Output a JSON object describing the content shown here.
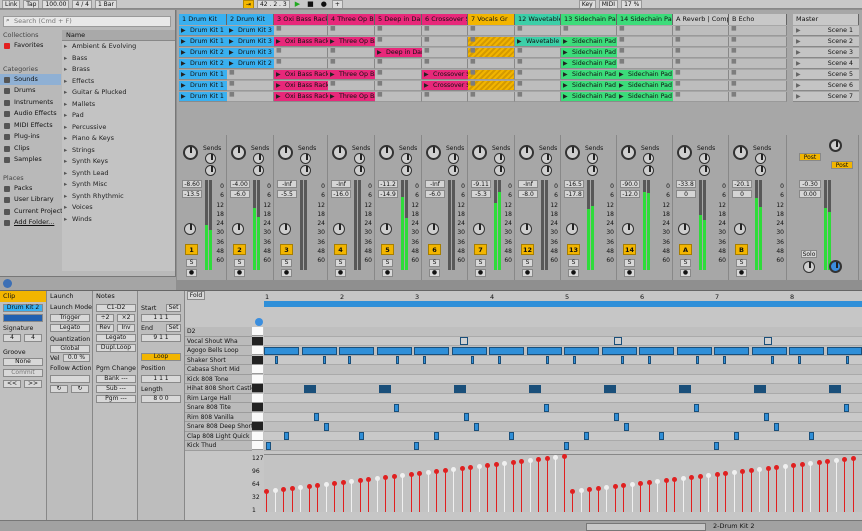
{
  "toolbar": {
    "link": "Link",
    "tap": "Tap",
    "tempo": "100.00",
    "meter": "4 / 4",
    "quant": "1 Bar",
    "position": "42 . 2 . 3",
    "key": "Key",
    "midi": "MIDI",
    "cpu": "17 %"
  },
  "browser": {
    "search_placeholder": "Search (Cmd + F)",
    "collections_header": "Collections",
    "favorites": "Favorites",
    "categories_header": "Categories",
    "categories": [
      "Sounds",
      "Drums",
      "Instruments",
      "Audio Effects",
      "MIDI Effects",
      "Plug-ins",
      "Clips",
      "Samples"
    ],
    "places_header": "Places",
    "places": [
      "Packs",
      "User Library",
      "Current Project",
      "Add Folder..."
    ],
    "list_header": "Name",
    "list": [
      "Ambient & Evolving",
      "Bass",
      "Brass",
      "Effects",
      "Guitar & Plucked",
      "Mallets",
      "Pad",
      "Percussive",
      "Piano & Keys",
      "Strings",
      "Synth Keys",
      "Synth Lead",
      "Synth Misc",
      "Synth Rhythmic",
      "Voices",
      "Winds"
    ]
  },
  "tracks": [
    {
      "name": "1 Drum Kit",
      "color": "#39b0f0",
      "clips": [
        "Drum Kit 1",
        "Drum Kit 1",
        "Drum Kit 2",
        "Drum Kit 2",
        "Drum Kit 1",
        "Drum Kit 1",
        "Drum Kit 1"
      ],
      "num": "1",
      "vol": "-8.60",
      "pan": "-13.5"
    },
    {
      "name": "2 Drum Kit",
      "color": "#39b0f0",
      "clips": [
        "Drum Kit 3",
        "Drum Kit 3",
        "Drum Kit 3",
        "Drum Kit 2",
        "",
        "",
        ""
      ],
      "num": "2",
      "vol": "-4.00",
      "pan": "-6.0"
    },
    {
      "name": "3 Oxi Bass Rack",
      "color": "#e8287a",
      "clips": [
        "",
        "Oxi Bass Rack",
        "",
        "",
        "Oxi Bass Rack",
        "Oxi Bass Rack",
        "Oxi Bass Rack"
      ],
      "num": "3",
      "vol": "-Inf",
      "pan": "-5.5"
    },
    {
      "name": "4 Three Op Ba",
      "color": "#e8287a",
      "clips": [
        "",
        "Three Op Bass",
        "",
        "",
        "Three Op Bass",
        "",
        "Three Op Bass"
      ],
      "num": "4",
      "vol": "-Inf",
      "pan": "-16.0"
    },
    {
      "name": "5 Deep in Dark",
      "color": "#e8287a",
      "clips": [
        "",
        "",
        "Deep in Dark",
        "",
        "",
        "",
        ""
      ],
      "num": "5",
      "vol": "-11.2",
      "pan": "-14.9"
    },
    {
      "name": "6 Crossover Sy",
      "color": "#e8287a",
      "clips": [
        "",
        "",
        "",
        "",
        "Crossover Sy",
        "Crossover Sy",
        ""
      ],
      "num": "6",
      "vol": "-Inf",
      "pan": "-6.0"
    },
    {
      "name": "7 Vocals Gr",
      "color": "#f2b500",
      "clips": [
        "",
        "hatch",
        "hatch",
        "",
        "hatch",
        "hatch",
        ""
      ],
      "num": "7",
      "vol": "-9.11",
      "pan": "-5.3"
    },
    {
      "name": "12 Wavetable",
      "color": "#3ccfa8",
      "clips": [
        "",
        "Wavetable",
        "",
        "",
        "",
        "",
        ""
      ],
      "num": "12",
      "vol": "-Inf",
      "pan": "-8.0"
    },
    {
      "name": "13 Sidechain Pad",
      "color": "#3cdc7a",
      "clips": [
        "",
        "Sidechain Pad",
        "Sidechain Pad",
        "Sidechain Pad",
        "Sidechain Pad",
        "Sidechain Pad",
        "Sidechain Pad"
      ],
      "num": "13",
      "vol": "-16.5",
      "pan": "-17.8"
    },
    {
      "name": "14 Sidechain Pad",
      "color": "#3cdc7a",
      "clips": [
        "",
        "",
        "",
        "",
        "Sidechain Pad",
        "Sidechain Pad",
        "Sidechain Pad"
      ],
      "num": "14",
      "vol": "-90.0",
      "pan": "-12.0"
    },
    {
      "name": "A Reverb | Compre",
      "color": "#c8c8c8",
      "clips": [
        "",
        "",
        "",
        "",
        "",
        "",
        ""
      ],
      "num": "A",
      "vol": "-33.8",
      "pan": "0"
    },
    {
      "name": "B Echo",
      "color": "#c8c8c8",
      "clips": [
        "",
        "",
        "",
        "",
        "",
        "",
        ""
      ],
      "num": "B",
      "vol": "-20.1",
      "pan": "0"
    }
  ],
  "master": {
    "name": "Master",
    "scenes": [
      "Scene 1",
      "Scene 2",
      "Scene 3",
      "Scene 4",
      "Scene 5",
      "Scene 6",
      "Scene 7"
    ],
    "vol": "-0.30",
    "pan": "0.00",
    "post": "Post",
    "solo": "Solo"
  },
  "mixer": {
    "sends": "Sends",
    "db_scale": [
      "0",
      "6",
      "12",
      "18",
      "24",
      "30",
      "36",
      "48",
      "60"
    ]
  },
  "clipview": {
    "clip_tab": "Clip",
    "clip_name": "Drum Kit 2",
    "signature_label": "Signature",
    "sig_num": "4",
    "sig_den": "4",
    "groove_label": "Groove",
    "groove_val": "None",
    "commit": "Commit",
    "launch_tab": "Launch",
    "launch_mode_label": "Launch Mode",
    "launch_mode": "Trigger",
    "legato": "Legato",
    "quant_label": "Quantization",
    "quant_val": "Global",
    "vel_label": "Vel",
    "vel_val": "0.0 %",
    "follow_label": "Follow Action",
    "notes_tab": "Notes",
    "range": "C1-D2",
    "rev": "Rev",
    "inv": "Inv",
    "legato2": "Legato",
    "dupl": "Dupl.Loop",
    "pgm_label": "Pgm Change",
    "bank": "Bank ---",
    "sub": "Sub ---",
    "pgm": "Pgm ---",
    "start_label": "Start",
    "end_label": "End",
    "loop": "Loop",
    "position_label": "Position",
    "length_label": "Length",
    "set": "Set",
    "fold": "Fold",
    "half": "÷2",
    "double": "×2"
  },
  "pianoroll": {
    "ruler": [
      "1",
      "2",
      "3",
      "4",
      "5",
      "6",
      "7",
      "8"
    ],
    "rows": [
      "D2",
      "Vocal Shout Wha",
      "Agogo Bells Loop",
      "Shaker Short",
      "Cabasa Short Mid",
      "Kick 808 Tone",
      "Hihat 808 Short Castle",
      "Rim Large Hall",
      "Snare 808 Tite",
      "Rim 808 Vanilla",
      "Snare 808 Deep Short",
      "Clap 808 Light Quick",
      "Kick Thud"
    ],
    "vel_scale": [
      "127",
      "96",
      "64",
      "32",
      "1"
    ]
  },
  "status": {
    "track": "2-Drum Kit 2"
  }
}
